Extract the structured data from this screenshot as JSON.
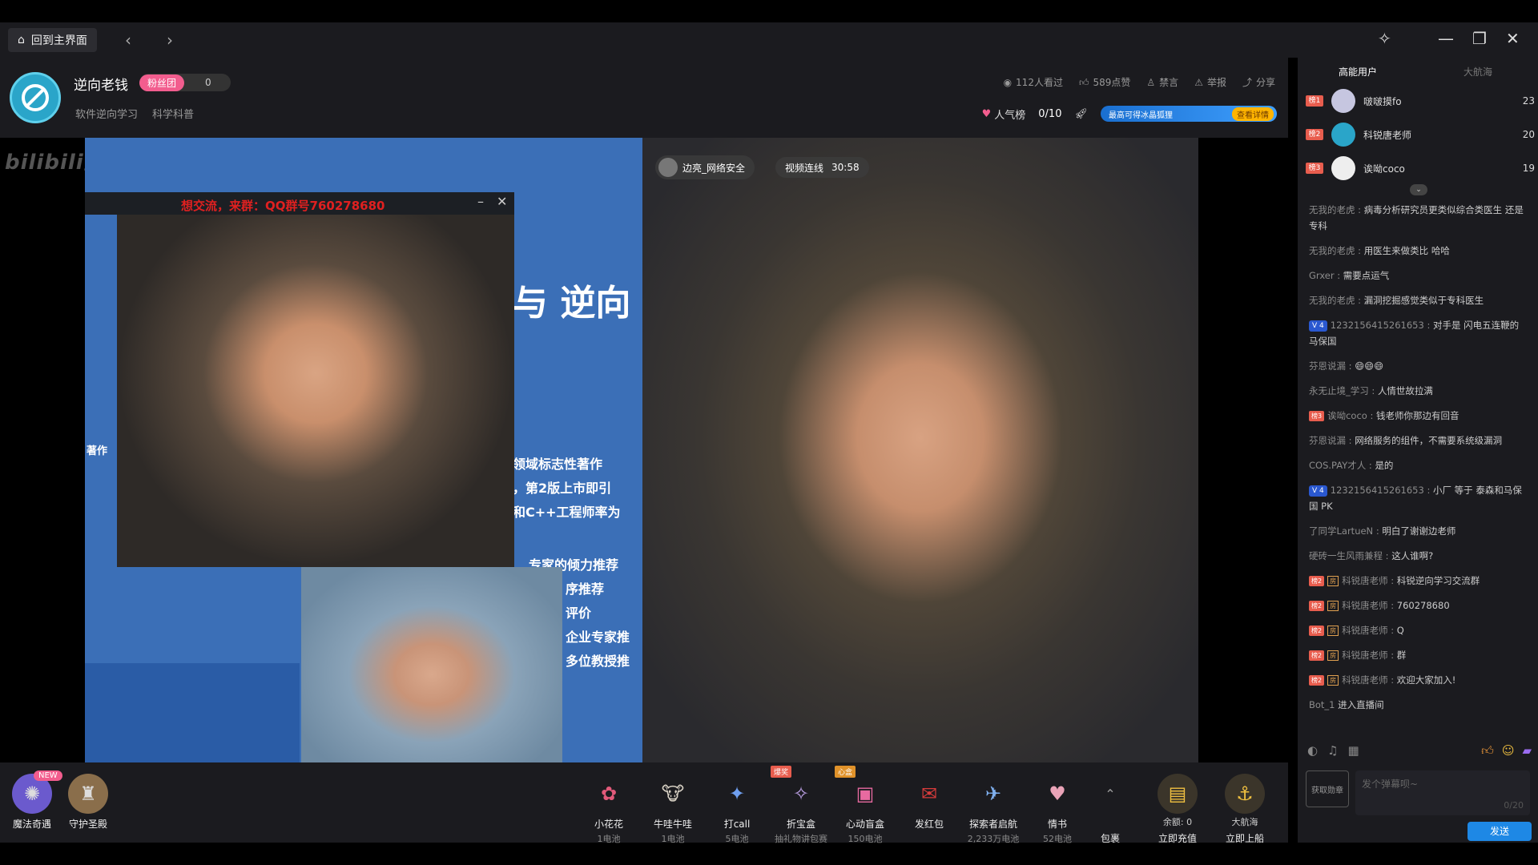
{
  "topbar": {
    "home_label": "回到主界面",
    "back_icon": "chevron-left",
    "forward_icon": "chevron-right"
  },
  "streamer": {
    "name": "逆向老钱",
    "fan_badge": "粉丝团",
    "fan_count": "0",
    "tags": [
      "软件逆向学习",
      "科学科普"
    ]
  },
  "stats": {
    "watching": "112人看过",
    "likes": "589点赞",
    "mute": "禁言",
    "report": "举报",
    "share": "分享"
  },
  "rank_row": {
    "popular_label": "人气榜",
    "progress": "0/10",
    "promo_text": "最高可得冰晶狐狸",
    "promo_button": "查看详情"
  },
  "video": {
    "logo": "bilibili直播",
    "pip_title": "想交流，来群：QQ群号760278680",
    "host_chip": "边亮_网络安全",
    "link_label": "视频连线",
    "link_time": "30:58",
    "slide_texts": [
      "与 逆向",
      "著作",
      "领域标志性著作",
      "，第2版上市即引",
      "和C++工程师率为",
      "专家的倾力推荐",
      "序推荐",
      "评价",
      "企业专家推",
      "多位教授推"
    ]
  },
  "sidebar": {
    "tabs": [
      "高能用户",
      "大航海"
    ],
    "top_users": [
      {
        "rank": "榜1",
        "name": "啵啵摸fo",
        "score": "23"
      },
      {
        "rank": "榜2",
        "name": "科锐唐老师",
        "score": "20"
      },
      {
        "rank": "榜3",
        "name": "诶呦coco",
        "score": "19"
      }
    ],
    "chat": [
      {
        "user": "无我的老虎",
        "text": "病毒分析研究员更类似综合类医生 还是专科",
        "level": "",
        "fan": "",
        "room": ""
      },
      {
        "user": "无我的老虎",
        "text": "用医生来做类比 哈哈",
        "level": "",
        "fan": "",
        "room": ""
      },
      {
        "user": "Grxer",
        "text": "需要点运气",
        "level": "",
        "fan": "",
        "room": ""
      },
      {
        "user": "无我的老虎",
        "text": "漏洞挖掘感觉类似于专科医生",
        "level": "",
        "fan": "",
        "room": ""
      },
      {
        "user": "1232156415261653",
        "text": "对手是 闪电五连鞭的 马保国",
        "level": "V 4",
        "fan": "",
        "room": ""
      },
      {
        "user": "芬恩说漏",
        "text": "😄😄😄",
        "level": "",
        "fan": "",
        "room": ""
      },
      {
        "user": "永无止境_学习",
        "text": "人情世故拉满",
        "level": "",
        "fan": "",
        "room": ""
      },
      {
        "user": "诶呦coco",
        "text": "钱老师你那边有回音",
        "level": "",
        "fan": "榜3",
        "room": ""
      },
      {
        "user": "芬恩说漏",
        "text": "网络服务的组件，不需要系统级漏洞",
        "level": "",
        "fan": "",
        "room": ""
      },
      {
        "user": "COS.PAY才人",
        "text": "是的",
        "level": "",
        "fan": "",
        "room": ""
      },
      {
        "user": "1232156415261653",
        "text": "小厂 等于 泰森和马保国 PK",
        "level": "V 4",
        "fan": "",
        "room": ""
      },
      {
        "user": "了同学LartueN",
        "text": "明白了谢谢边老师",
        "level": "",
        "fan": "",
        "room": ""
      },
      {
        "user": "硬砖一生风雨兼程",
        "text": "这人谁啊?",
        "level": "",
        "fan": "",
        "room": ""
      },
      {
        "user": "科锐唐老师",
        "text": "科锐逆向学习交流群",
        "level": "",
        "fan": "榜2",
        "room": "房"
      },
      {
        "user": "科锐唐老师",
        "text": "760278680",
        "level": "",
        "fan": "榜2",
        "room": "房"
      },
      {
        "user": "科锐唐老师",
        "text": "Q",
        "level": "",
        "fan": "榜2",
        "room": "房"
      },
      {
        "user": "科锐唐老师",
        "text": "群",
        "level": "",
        "fan": "榜2",
        "room": "房"
      },
      {
        "user": "科锐唐老师",
        "text": "欢迎大家加入!",
        "level": "",
        "fan": "榜2",
        "room": "房"
      },
      {
        "user": "Bot_1",
        "text": "进入直播间",
        "level": "",
        "fan": "",
        "room": ""
      }
    ],
    "get_medal": "获取勋章",
    "input_placeholder": "发个弹幕呗~",
    "input_count": "0/20",
    "send_label": "发送"
  },
  "gifts_left": [
    {
      "name": "魔法奇遇",
      "badge": "NEW",
      "color": "#6b5acd"
    },
    {
      "name": "守护圣殿",
      "badge": "",
      "color": "#8a6e4b"
    }
  ],
  "gifts": [
    {
      "name": "小花花",
      "price": "1电池",
      "tag": "",
      "color": "#e25a7a",
      "glyph": "✿"
    },
    {
      "name": "牛哇牛哇",
      "price": "1电池",
      "tag": "",
      "color": "#d9d2c5",
      "glyph": "🐮"
    },
    {
      "name": "打call",
      "price": "5电池",
      "tag": "",
      "color": "#3f6fd1",
      "glyph": "✦"
    },
    {
      "name": "折宝盒",
      "price": "抽礼物讲包赛",
      "tag": "爆奖",
      "color": "#9a7bc7",
      "glyph": "✧"
    },
    {
      "name": "心动盲盒",
      "price": "150电池",
      "tag": "心盒",
      "color": "#e86aa0",
      "glyph": "▣"
    },
    {
      "name": "发红包",
      "price": "",
      "tag": "",
      "color": "#d83b3b",
      "glyph": "✉"
    },
    {
      "name": "探索者启航",
      "price": "2,233万电池",
      "tag": "",
      "color": "#5a8fd6",
      "glyph": "✈"
    },
    {
      "name": "情书",
      "price": "52电池",
      "tag": "",
      "color": "#e9a3b7",
      "glyph": "♥"
    }
  ],
  "gift_extras": {
    "bag_label": "包裹",
    "balance": "余额: 0",
    "recharge": "立即充值",
    "captain": "大航海",
    "board": "立即上船"
  }
}
